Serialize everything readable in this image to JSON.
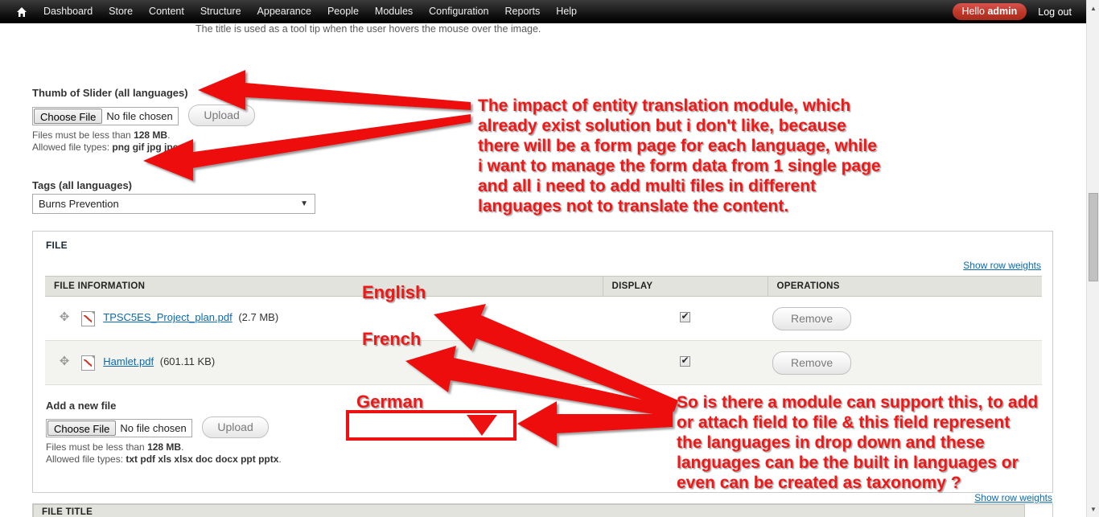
{
  "toolbar": {
    "home_icon": "home-icon",
    "menu": [
      {
        "label": "Dashboard"
      },
      {
        "label": "Store"
      },
      {
        "label": "Content"
      },
      {
        "label": "Structure"
      },
      {
        "label": "Appearance"
      },
      {
        "label": "People"
      },
      {
        "label": "Modules"
      },
      {
        "label": "Configuration"
      },
      {
        "label": "Reports"
      },
      {
        "label": "Help"
      }
    ],
    "hello_prefix": "Hello ",
    "hello_user": "admin",
    "logout": "Log out",
    "hello_bg": "#c0392b"
  },
  "page": {
    "top_hint": "The title is used as a tool tip when the user hovers the mouse over the image.",
    "thumb_field": {
      "label": "Thumb of Slider (all languages)",
      "choose_button": "Choose File",
      "file_value": "No file chosen",
      "upload_button": "Upload",
      "desc_line1_prefix": "Files must be less than ",
      "desc_line1_bold": "128 MB",
      "desc_line1_suffix": ".",
      "desc_line2_prefix": "Allowed file types: ",
      "desc_line2_bold": "png gif jpg jpeg",
      "desc_line2_suffix": "."
    },
    "tags_field": {
      "label": "Tags (all languages)",
      "selected": "Burns Prevention",
      "caret": "chevron-down-icon"
    },
    "file_fieldset": {
      "legend": "FILE",
      "show_row_weights": "Show row weights",
      "columns": [
        "FILE INFORMATION",
        "DISPLAY",
        "OPERATIONS"
      ],
      "rows": [
        {
          "drag": "drag-handle-icon",
          "icon": "pdf-file-icon",
          "name": "TPSC5ES_Project_plan.pdf",
          "size": "(2.7 MB)",
          "display_checked": true,
          "operation": "Remove"
        },
        {
          "drag": "drag-handle-icon",
          "icon": "pdf-file-icon",
          "name": "Hamlet.pdf",
          "size": "(601.11 KB)",
          "display_checked": true,
          "operation": "Remove"
        }
      ],
      "add_new": {
        "label": "Add a new file",
        "choose_button": "Choose File",
        "file_value": "No file chosen",
        "upload_button": "Upload",
        "desc_line1_prefix": "Files must be less than ",
        "desc_line1_bold": "128 MB",
        "desc_line1_suffix": ".",
        "desc_line2_prefix": "Allowed file types: ",
        "desc_line2_bold": "txt pdf xls xlsx doc docx ppt pptx",
        "desc_line2_suffix": "."
      }
    },
    "bottom": {
      "show_row_weights": "Show row weights",
      "file_title_header": "FILE TITLE"
    }
  },
  "annotations": {
    "color": "#f21717",
    "top_note": "The impact of entity translation module, which\nalready exist solution but i don't like, because\nthere will be a form page for each language, while\ni want to manage the form data from 1 single page\nand all i need to add multi files in different\nlanguages not to translate the content.",
    "bottom_note": "So is there a module can support this, to add\nor attach field to file & this field represent\nthe languages in drop down and these\nlanguages can be the built in languages or\neven can be created as taxonomy ?",
    "lang_english": "English",
    "lang_french": "French",
    "lang_german": "German"
  },
  "scrollbar": {
    "up_arrow": "scroll-up-arrow-icon",
    "down_arrow": "scroll-down-arrow-icon"
  }
}
